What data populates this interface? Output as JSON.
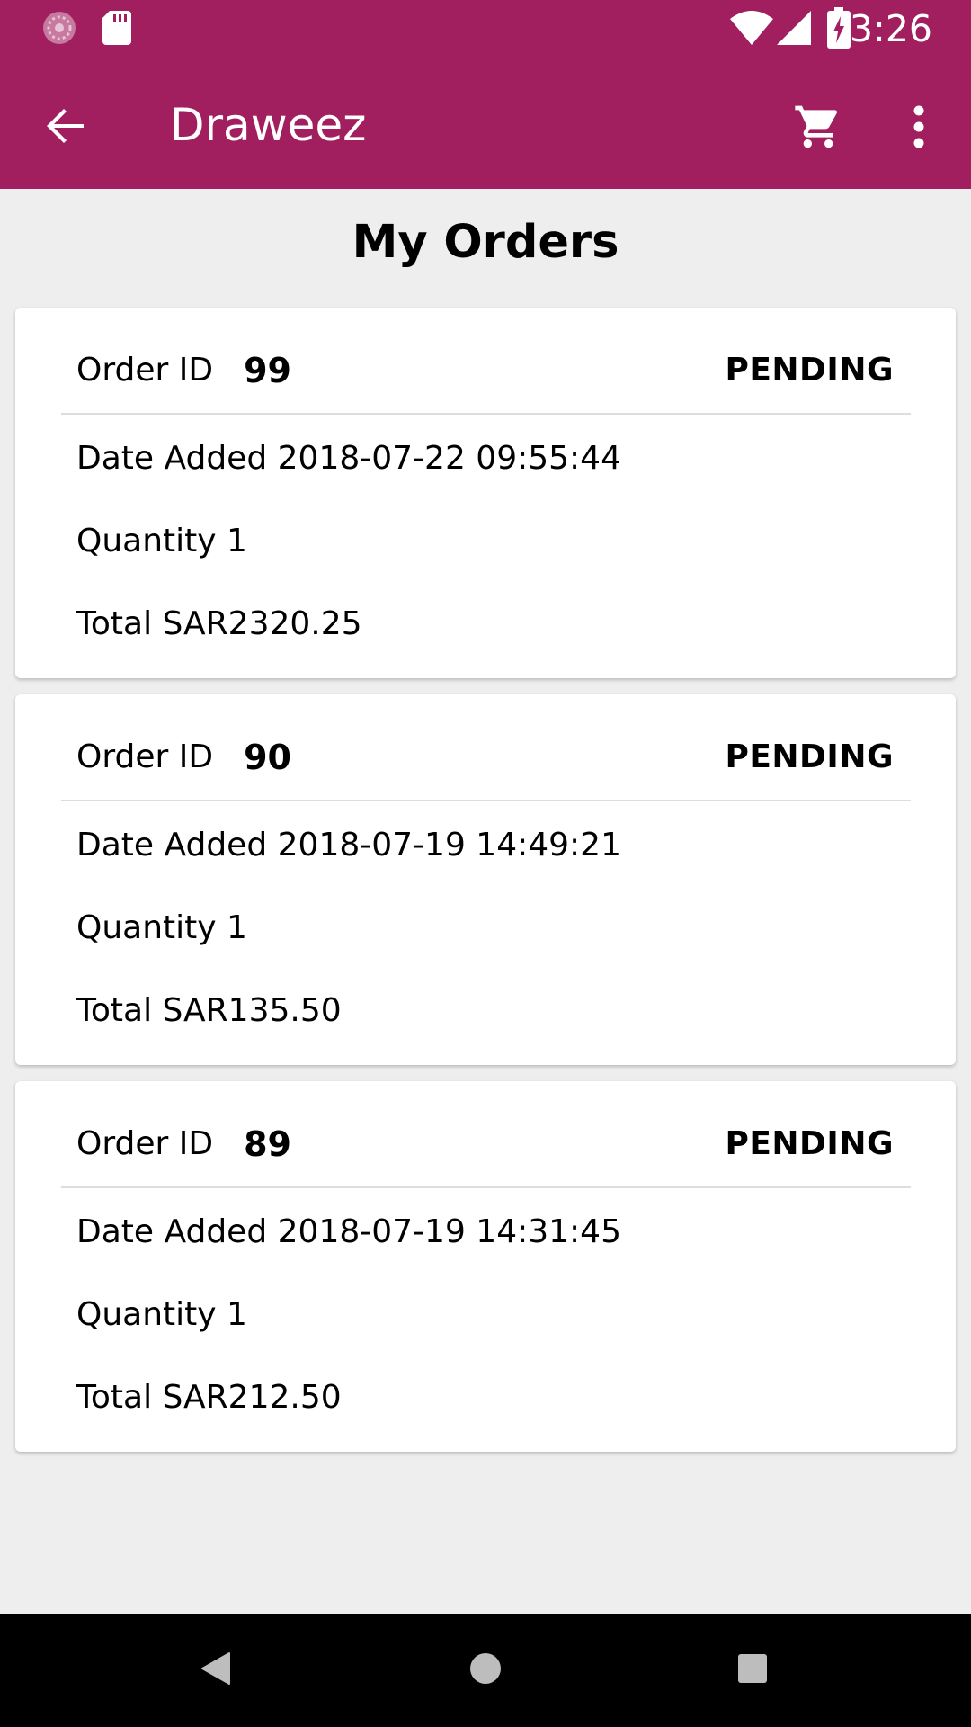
{
  "status_bar": {
    "time": "3:26",
    "icons": [
      "camera-notification-icon",
      "sd-card-icon",
      "wifi-icon",
      "signal-icon",
      "battery-charging-icon"
    ]
  },
  "app_bar": {
    "title": "Draweez",
    "icons": [
      "back-arrow-icon",
      "cart-icon",
      "more-vert-icon"
    ]
  },
  "page": {
    "title": "My Orders"
  },
  "orders": [
    {
      "id_label": "Order ID",
      "id": "99",
      "status": "PENDING",
      "date": "Date Added 2018-07-22 09:55:44",
      "quantity": "Quantity 1",
      "total": "Total SAR2320.25"
    },
    {
      "id_label": "Order ID",
      "id": "90",
      "status": "PENDING",
      "date": "Date Added 2018-07-19 14:49:21",
      "quantity": "Quantity 1",
      "total": "Total SAR135.50"
    },
    {
      "id_label": "Order ID",
      "id": "89",
      "status": "PENDING",
      "date": "Date Added 2018-07-19 14:31:45",
      "quantity": "Quantity 1",
      "total": "Total SAR212.50"
    }
  ],
  "nav_bar": {
    "icons": [
      "back-triangle-icon",
      "home-circle-icon",
      "recents-square-icon"
    ]
  },
  "colors": {
    "primary": "#a11f5f",
    "background": "#eeeeee",
    "card": "#ffffff",
    "text": "#000000"
  }
}
